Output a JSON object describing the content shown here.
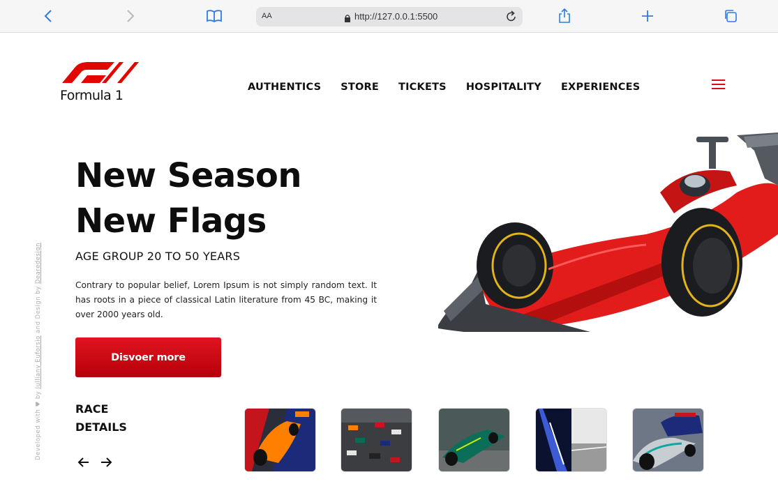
{
  "browser": {
    "aa_label": "AA",
    "url": "http://127.0.0.1:5500"
  },
  "brand": {
    "logo_text": "Formula 1",
    "accent": "#d0101b"
  },
  "nav": {
    "items": [
      "AUTHENTICS",
      "STORE",
      "TICKETS",
      "HOSPITALITY",
      "EXPERIENCES"
    ]
  },
  "hero": {
    "title_line1": "New Season",
    "title_line2": "New Flags",
    "subtitle": "AGE GROUP 20 TO 50 YEARS",
    "description": "Contrary to popular belief, Lorem Ipsum is not simply random text. It has roots in a piece of classical Latin literature from 45 BC, making it over 2000 years old.",
    "cta_label": "Disvoer more"
  },
  "credit": {
    "prefix": "Developed with ♥ by",
    "dev_name": "Julliany Euforsio",
    "middle": "and Design by",
    "design_name": "Dearedesign"
  },
  "race": {
    "title_line1": "RACE",
    "title_line2": "DETAILS",
    "prev_icon": "arrow-left-icon",
    "next_icon": "arrow-right-icon"
  },
  "gallery": {
    "thumbnails": [
      "mclaren-car",
      "race-grid",
      "aston-martin-car",
      "night-race-split",
      "mercedes-redbull-cars"
    ]
  }
}
